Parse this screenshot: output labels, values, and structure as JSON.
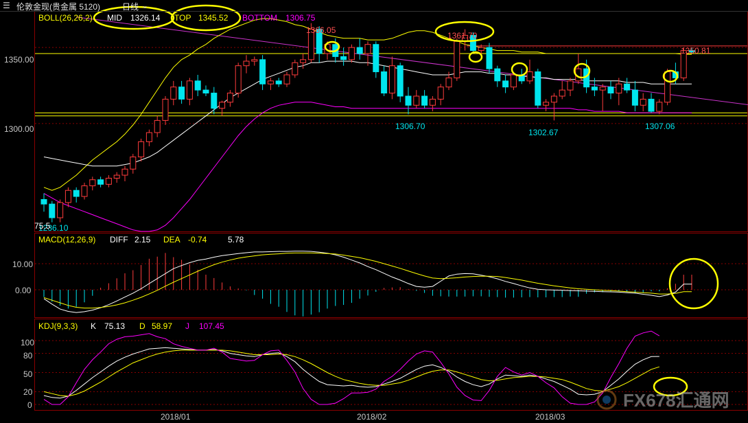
{
  "window": {
    "title": "伦敦金现(贵金属 5120)",
    "period": "日线",
    "dropdown_icon": "chevron-down-icon"
  },
  "boll_panel": {
    "name": "BOLL(26,26,2)",
    "mid_label": "MID",
    "mid_value": "1326.14",
    "top_label": "TOP",
    "top_value": "1345.52",
    "bottom_label": "BOTTOM",
    "bottom_value": "1306.75",
    "y_ticks": [
      "1350.00",
      "1300.00"
    ],
    "annotations": [
      "1366.05",
      "1361.70",
      "1350.81",
      "1306.70",
      "1302.67",
      "1307.06",
      "1236.10",
      "75.5"
    ]
  },
  "macd_panel": {
    "name": "MACD(12,26,9)",
    "diff_label": "DIFF",
    "diff_value": "2.15",
    "dea_label": "DEA",
    "dea_value": "-0.74",
    "macd_value": "5.78",
    "y_ticks": [
      "10.00",
      "0.00"
    ]
  },
  "kdj_panel": {
    "name": "KDJ(9,3,3)",
    "k_label": "K",
    "k_value": "75.13",
    "d_label": "D",
    "d_value": "58.97",
    "j_label": "J",
    "j_value": "107.45",
    "y_ticks": [
      "100",
      "80",
      "50",
      "20",
      "0"
    ]
  },
  "x_axis": {
    "labels": [
      "2018/01",
      "2018/02",
      "2018/03"
    ]
  },
  "watermark": {
    "text": "FX678汇通网"
  },
  "colors": {
    "background": "#000000",
    "up": "#ff3c3c",
    "down": "#00e5ee",
    "mid": "#ffffff",
    "top": "#ffff00",
    "bottom": "#ff00ff",
    "highlight": "#ffff00",
    "trend": "#cc33cc",
    "grid": "#8b0000"
  },
  "chart_data": {
    "type": "candlestick",
    "price_range": [
      1229,
      1374
    ],
    "candles": [
      [
        1250,
        1254,
        1242,
        1247
      ],
      [
        1247,
        1249,
        1235,
        1238
      ],
      [
        1238,
        1250,
        1235,
        1248
      ],
      [
        1248,
        1258,
        1245,
        1256
      ],
      [
        1256,
        1258,
        1248,
        1252
      ],
      [
        1252,
        1261,
        1250,
        1259
      ],
      [
        1259,
        1265,
        1256,
        1263
      ],
      [
        1263,
        1265,
        1258,
        1260
      ],
      [
        1260,
        1266,
        1258,
        1264
      ],
      [
        1264,
        1268,
        1261,
        1266
      ],
      [
        1266,
        1272,
        1262,
        1270
      ],
      [
        1270,
        1280,
        1267,
        1278
      ],
      [
        1278,
        1290,
        1275,
        1288
      ],
      [
        1288,
        1296,
        1285,
        1294
      ],
      [
        1294,
        1305,
        1291,
        1302
      ],
      [
        1302,
        1318,
        1299,
        1316
      ],
      [
        1316,
        1328,
        1312,
        1324
      ],
      [
        1324,
        1328,
        1313,
        1316
      ],
      [
        1316,
        1330,
        1312,
        1328
      ],
      [
        1328,
        1332,
        1318,
        1322
      ],
      [
        1322,
        1325,
        1318,
        1320
      ],
      [
        1320,
        1324,
        1306,
        1310
      ],
      [
        1310,
        1315,
        1305,
        1314
      ],
      [
        1314,
        1322,
        1311,
        1320
      ],
      [
        1320,
        1340,
        1317,
        1338
      ],
      [
        1338,
        1345,
        1333,
        1341
      ],
      [
        1341,
        1344,
        1338,
        1342
      ],
      [
        1342,
        1345,
        1322,
        1326
      ],
      [
        1326,
        1330,
        1322,
        1328
      ],
      [
        1328,
        1330,
        1324,
        1326
      ],
      [
        1326,
        1334,
        1324,
        1332
      ],
      [
        1332,
        1342,
        1330,
        1340
      ],
      [
        1340,
        1346,
        1336,
        1342
      ],
      [
        1342,
        1366,
        1340,
        1362
      ],
      [
        1362,
        1364,
        1340,
        1346
      ],
      [
        1346,
        1354,
        1342,
        1352
      ],
      [
        1352,
        1356,
        1340,
        1344
      ],
      [
        1344,
        1350,
        1338,
        1342
      ],
      [
        1342,
        1352,
        1340,
        1350
      ],
      [
        1350,
        1356,
        1342,
        1346
      ],
      [
        1346,
        1354,
        1338,
        1352
      ],
      [
        1352,
        1354,
        1330,
        1334
      ],
      [
        1334,
        1338,
        1318,
        1320
      ],
      [
        1320,
        1344,
        1316,
        1338
      ],
      [
        1338,
        1340,
        1314,
        1318
      ],
      [
        1318,
        1324,
        1306,
        1312
      ],
      [
        1312,
        1322,
        1310,
        1318
      ],
      [
        1318,
        1322,
        1310,
        1312
      ],
      [
        1312,
        1318,
        1308,
        1316
      ],
      [
        1316,
        1326,
        1312,
        1324
      ],
      [
        1324,
        1334,
        1322,
        1330
      ],
      [
        1330,
        1356,
        1328,
        1354
      ],
      [
        1354,
        1362,
        1348,
        1358
      ],
      [
        1358,
        1360,
        1346,
        1348
      ],
      [
        1348,
        1352,
        1344,
        1350
      ],
      [
        1350,
        1353,
        1333,
        1336
      ],
      [
        1336,
        1338,
        1324,
        1328
      ],
      [
        1328,
        1332,
        1320,
        1324
      ],
      [
        1324,
        1334,
        1322,
        1332
      ],
      [
        1332,
        1336,
        1326,
        1328
      ],
      [
        1328,
        1342,
        1326,
        1334
      ],
      [
        1334,
        1336,
        1310,
        1312
      ],
      [
        1312,
        1316,
        1308,
        1314
      ],
      [
        1314,
        1320,
        1302,
        1318
      ],
      [
        1318,
        1328,
        1316,
        1322
      ],
      [
        1322,
        1330,
        1318,
        1328
      ],
      [
        1328,
        1346,
        1326,
        1336
      ],
      [
        1336,
        1342,
        1320,
        1324
      ],
      [
        1324,
        1330,
        1318,
        1322
      ],
      [
        1322,
        1326,
        1308,
        1324
      ],
      [
        1324,
        1328,
        1316,
        1320
      ],
      [
        1320,
        1330,
        1312,
        1326
      ],
      [
        1326,
        1330,
        1320,
        1322
      ],
      [
        1322,
        1328,
        1308,
        1312
      ],
      [
        1312,
        1320,
        1308,
        1316
      ],
      [
        1316,
        1320,
        1307,
        1308
      ],
      [
        1308,
        1316,
        1306,
        1314
      ],
      [
        1314,
        1336,
        1312,
        1334
      ],
      [
        1334,
        1340,
        1326,
        1330
      ],
      [
        1330,
        1350,
        1328,
        1348
      ],
      [
        1348,
        1350,
        1346,
        1347
      ]
    ],
    "boll": {
      "top": [
        1258,
        1256,
        1258,
        1262,
        1266,
        1271,
        1276,
        1280,
        1284,
        1288,
        1293,
        1299,
        1306,
        1314,
        1322,
        1330,
        1337,
        1342,
        1345,
        1349,
        1352,
        1356,
        1359,
        1362,
        1364,
        1366,
        1368,
        1369,
        1369,
        1368,
        1367,
        1365,
        1364,
        1362,
        1360,
        1358,
        1357,
        1356,
        1356,
        1356,
        1355,
        1355,
        1355,
        1356,
        1358,
        1360,
        1361,
        1361,
        1360,
        1358,
        1356,
        1354,
        1352,
        1351,
        1350,
        1349,
        1348,
        1348,
        1348,
        1347,
        1347,
        1347,
        1346,
        1346,
        1346,
        1346,
        1346,
        1346,
        1346,
        1346,
        1346,
        1346,
        1346,
        1346,
        1346,
        1346,
        1346,
        1346,
        1346,
        1345.5,
        1345.5
      ],
      "mid": [
        1278,
        1277,
        1276,
        1275,
        1274,
        1273,
        1272,
        1272,
        1272,
        1272,
        1273,
        1274,
        1276,
        1278,
        1281,
        1285,
        1289,
        1293,
        1297,
        1301,
        1305,
        1309,
        1313,
        1317,
        1320,
        1323,
        1326,
        1329,
        1331,
        1333,
        1335,
        1337,
        1338,
        1340,
        1340,
        1341,
        1341,
        1341,
        1341,
        1340,
        1340,
        1339,
        1338,
        1337,
        1336,
        1335,
        1334,
        1333,
        1332,
        1332,
        1332,
        1333,
        1334,
        1334,
        1334,
        1333,
        1333,
        1332,
        1332,
        1331,
        1331,
        1330,
        1330,
        1329,
        1329,
        1329,
        1329,
        1328,
        1328,
        1328,
        1328,
        1328,
        1327,
        1327,
        1327,
        1326,
        1326,
        1326,
        1326,
        1326,
        1326
      ],
      "bottom": [
        1254,
        1251,
        1248,
        1246,
        1244,
        1242,
        1240,
        1238,
        1236,
        1234,
        1232,
        1230,
        1229,
        1229,
        1230,
        1233,
        1238,
        1244,
        1250,
        1257,
        1264,
        1271,
        1278,
        1285,
        1292,
        1298,
        1303,
        1307,
        1310,
        1312,
        1313,
        1314,
        1314,
        1314,
        1313,
        1312,
        1311,
        1311,
        1310,
        1310,
        1310,
        1310,
        1310,
        1310,
        1310,
        1310,
        1310,
        1310,
        1310,
        1310,
        1310,
        1310,
        1310,
        1310,
        1310,
        1310,
        1310,
        1310,
        1310,
        1310,
        1310,
        1310,
        1310,
        1310,
        1310,
        1310,
        1309,
        1309,
        1308,
        1308,
        1308,
        1308,
        1307,
        1307,
        1307,
        1307,
        1307,
        1307,
        1307,
        1307,
        1307
      ]
    },
    "horizontal_levels": [
      1351,
      1346,
      1307,
      1305
    ],
    "trendline": [
      [
        1370,
        4
      ],
      [
        1318,
        85
      ]
    ],
    "macd": {
      "diff": [
        -3.4,
        -5.5,
        -7.4,
        -8.3,
        -8.7,
        -8.4,
        -7.8,
        -6.9,
        -5.7,
        -4.3,
        -2.8,
        -1.3,
        0.4,
        2.4,
        4.3,
        6.2,
        8.1,
        9.3,
        10.4,
        11.3,
        11.8,
        12.5,
        13.1,
        13.5,
        13.9,
        14.2,
        14.5,
        14.5,
        14.6,
        14.7,
        14.7,
        14.8,
        14.8,
        14.7,
        14.4,
        14.0,
        13.4,
        12.5,
        11.4,
        10.3,
        8.9,
        7.7,
        6.3,
        4.9,
        3.7,
        2.4,
        1.3,
        1.0,
        1.3,
        3.3,
        5.3,
        6.0,
        6.2,
        6.1,
        5.6,
        5.0,
        4.2,
        3.2,
        2.4,
        1.5,
        0.7,
        0.2,
        0.0,
        -0.1,
        -0.2,
        -0.3,
        -0.4,
        -0.5,
        -0.6,
        -0.7,
        -0.8,
        -0.9,
        -1.1,
        -1.3,
        -1.7,
        -2.1,
        -2.6,
        -2.0,
        -0.9,
        2.15,
        2.15
      ],
      "dea": [
        -3.0,
        -4.0,
        -5.0,
        -6.0,
        -6.7,
        -7.0,
        -7.0,
        -6.8,
        -6.4,
        -5.8,
        -5.0,
        -4.0,
        -2.9,
        -1.6,
        -0.2,
        1.4,
        2.9,
        4.3,
        5.7,
        7.1,
        8.4,
        9.6,
        10.6,
        11.4,
        12.1,
        12.6,
        13.0,
        13.4,
        13.6,
        13.8,
        14.0,
        14.1,
        14.1,
        14.1,
        14.0,
        13.9,
        13.7,
        13.3,
        12.8,
        12.3,
        11.6,
        10.9,
        10.0,
        9.1,
        8.2,
        7.2,
        6.2,
        5.3,
        4.5,
        4.3,
        4.4,
        4.6,
        4.9,
        5.1,
        5.2,
        5.2,
        5.1,
        4.7,
        4.2,
        3.7,
        3.1,
        2.5,
        2.0,
        1.5,
        1.1,
        0.7,
        0.4,
        0.2,
        0.0,
        -0.2,
        -0.3,
        -0.5,
        -0.7,
        -0.9,
        -1.1,
        -1.3,
        -1.6,
        -1.6,
        -1.4,
        -0.74,
        -0.74
      ],
      "hist": [
        -2.8,
        -4.6,
        -6.1,
        -7.2,
        -6.5,
        -4.8,
        -2.3,
        0.8,
        2.5,
        4.4,
        6.3,
        7.5,
        9.5,
        11.9,
        12.7,
        14.1,
        12.5,
        11.5,
        9.7,
        7.7,
        5.8,
        4.5,
        2.8,
        1.3,
        0.5,
        -0.2,
        -2.0,
        -3.4,
        -5.4,
        -6.5,
        -8.5,
        -9.8,
        -10.2,
        -9.5,
        -8.6,
        -7.2,
        -6.2,
        -5.8,
        -5.0,
        -3.4,
        -2.2,
        -0.8,
        0.7,
        0.9,
        1.0,
        0.3,
        -0.4,
        -1.2,
        -2.3,
        -2.5,
        -2.6,
        -2.6,
        -2.6,
        -2.5,
        -2.5,
        -2.7,
        -2.8,
        -3.0,
        -3.0,
        -2.9,
        -2.8,
        -2.9,
        -2.9,
        -2.8,
        -2.8,
        -2.6,
        -2.7,
        -1.5,
        -1.0,
        -0.9,
        -0.6,
        -0.4,
        -0.7,
        -1.2,
        -1.2,
        -0.6,
        -0.6,
        0.6,
        2.3,
        5.78,
        5.78
      ]
    },
    "kdj": {
      "k": [
        14,
        11,
        10,
        13,
        22,
        32,
        42,
        51,
        60,
        68,
        74,
        79,
        83,
        87,
        88,
        89,
        88,
        87,
        86,
        85,
        85,
        86,
        84,
        80,
        78,
        76,
        75,
        78,
        80,
        81,
        75,
        67,
        55,
        45,
        36,
        31,
        30,
        29,
        30,
        28,
        27,
        28,
        32,
        36,
        41,
        48,
        55,
        60,
        62,
        58,
        52,
        43,
        36,
        31,
        28,
        32,
        40,
        46,
        45,
        44,
        46,
        44,
        40,
        36,
        30,
        24,
        16,
        15,
        16,
        20,
        30,
        40,
        52,
        63,
        70,
        75,
        75.13
      ],
      "d": [
        20,
        17,
        14,
        13,
        16,
        21,
        28,
        35,
        43,
        51,
        58,
        65,
        70,
        75,
        79,
        82,
        84,
        85,
        85,
        85,
        85,
        85,
        85,
        84,
        82,
        80,
        78,
        78,
        78,
        79,
        78,
        75,
        70,
        64,
        57,
        50,
        44,
        39,
        36,
        33,
        31,
        30,
        30,
        32,
        34,
        38,
        43,
        48,
        52,
        54,
        54,
        51,
        47,
        43,
        39,
        37,
        38,
        40,
        42,
        43,
        44,
        44,
        43,
        41,
        39,
        35,
        30,
        25,
        22,
        21,
        24,
        28,
        34,
        41,
        48,
        55,
        58.97
      ],
      "j": [
        8,
        0,
        0,
        12,
        34,
        55,
        70,
        82,
        95,
        102,
        106,
        107,
        109,
        111,
        106,
        103,
        95,
        91,
        88,
        85,
        85,
        88,
        82,
        72,
        70,
        68,
        69,
        78,
        84,
        85,
        69,
        51,
        25,
        8,
        0,
        0,
        2,
        9,
        18,
        18,
        19,
        24,
        36,
        44,
        55,
        68,
        79,
        84,
        82,
        66,
        48,
        27,
        14,
        7,
        6,
        22,
        44,
        58,
        51,
        46,
        50,
        44,
        34,
        26,
        12,
        2,
        0,
        0,
        4,
        18,
        42,
        64,
        88,
        107,
        112,
        115,
        107.45
      ]
    }
  }
}
